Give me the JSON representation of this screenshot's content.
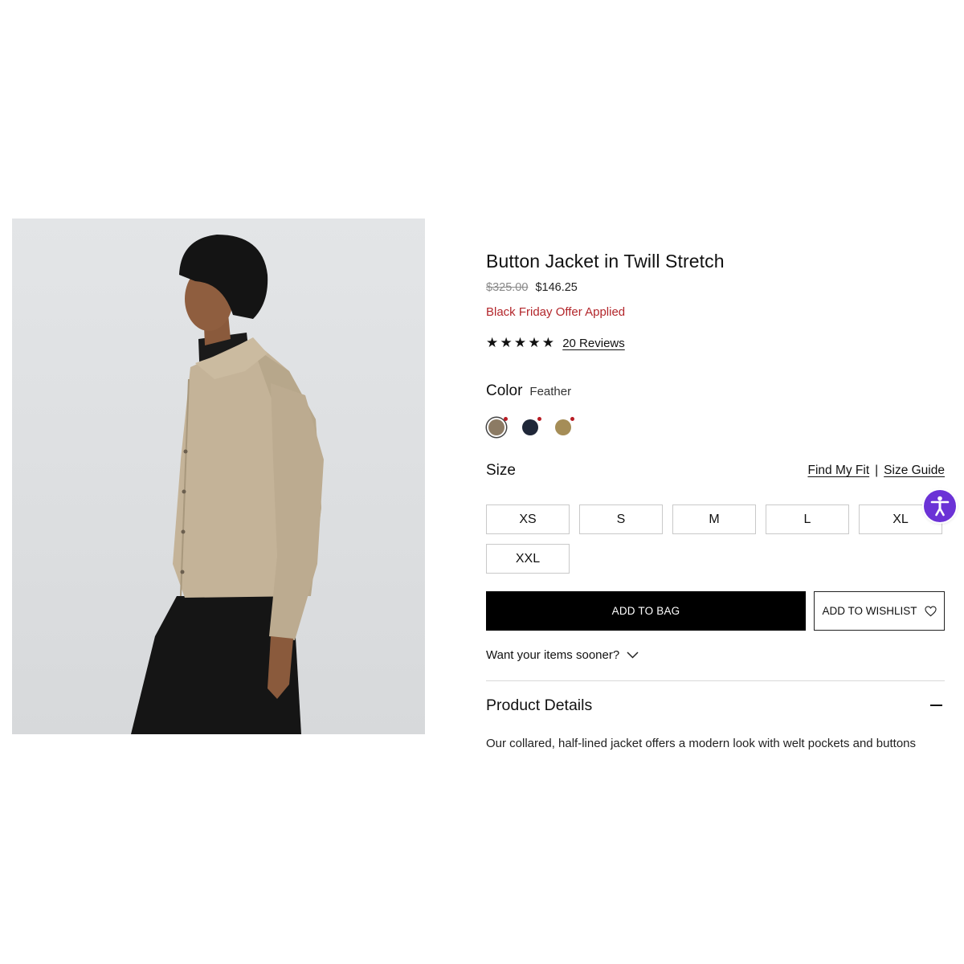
{
  "product": {
    "title": "Button Jacket in Twill Stretch",
    "original_price": "$325.00",
    "sale_price": "$146.25",
    "promo_text": "Black Friday Offer Applied",
    "rating_stars": "★★★★★",
    "rating": 5,
    "reviews_link": "20 Reviews"
  },
  "color": {
    "label": "Color",
    "selected_name": "Feather",
    "swatches": [
      {
        "name": "feather",
        "hex": "#8c7b64",
        "selected": true
      },
      {
        "name": "navy",
        "hex": "#1f2738",
        "selected": false
      },
      {
        "name": "khaki",
        "hex": "#a58d57",
        "selected": false
      }
    ]
  },
  "size": {
    "label": "Size",
    "find_fit": "Find My Fit",
    "separator": "|",
    "guide": "Size Guide",
    "options": [
      "XS",
      "S",
      "M",
      "L",
      "XL",
      "XXL"
    ]
  },
  "actions": {
    "add_to_bag": "ADD TO BAG",
    "add_to_wishlist": "ADD TO WISHLIST"
  },
  "shipping": {
    "sooner_text": "Want your items sooner?"
  },
  "details": {
    "heading": "Product Details",
    "description": "Our collared, half-lined jacket offers a modern look with welt pockets and buttons"
  },
  "colors": {
    "promo": "#b3262b",
    "accessibility_button": "#6b32d6",
    "primary_button": "#000000"
  },
  "icons": {
    "wishlist": "heart-outline-icon",
    "sooner": "chevron-down-icon",
    "details": "minus-icon",
    "accessibility": "accessibility-person-icon"
  }
}
